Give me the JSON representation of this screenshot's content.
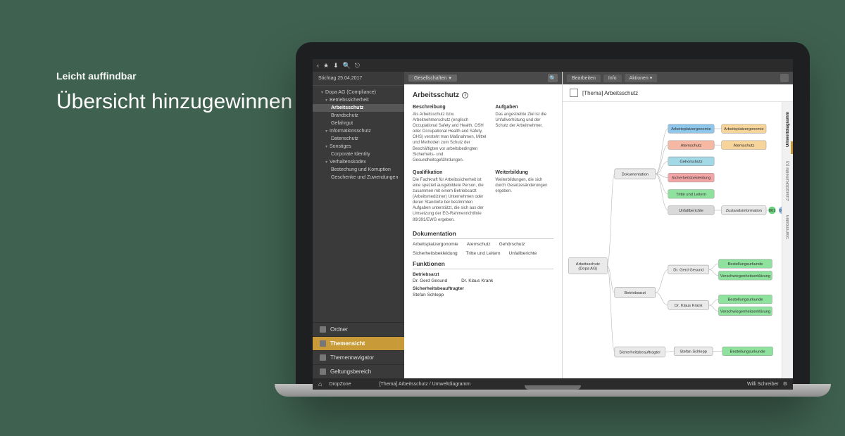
{
  "marketing": {
    "eyebrow": "Leicht auffindbar",
    "title": "Übersicht hinzugewinnen durch einheitliche Struktur."
  },
  "toolbar": {
    "icons": [
      "chevron-left",
      "star",
      "download",
      "search",
      "logout"
    ]
  },
  "sidebar": {
    "stichtag": "Stichtag 25.04.2017",
    "root": "Dopa AG (Compliance)",
    "tree": [
      {
        "label": "Betriebssicherheit",
        "open": true,
        "children": [
          {
            "label": "Arbeitsschutz",
            "selected": true
          },
          {
            "label": "Brandschutz"
          },
          {
            "label": "Gefahrgut"
          }
        ]
      },
      {
        "label": "Informationsschutz",
        "open": true,
        "children": [
          {
            "label": "Datenschutz"
          }
        ]
      },
      {
        "label": "Sonstiges",
        "open": true,
        "children": [
          {
            "label": "Corporate Identity"
          }
        ]
      },
      {
        "label": "Verhaltenskodex",
        "open": true,
        "children": [
          {
            "label": "Bestechung und Korruption"
          },
          {
            "label": "Geschenke und Zuwendungen"
          }
        ]
      }
    ],
    "nav": [
      {
        "label": "Ordner"
      },
      {
        "label": "Themensicht",
        "active": true
      },
      {
        "label": "Themennavigator"
      },
      {
        "label": "Geltungsbereich"
      }
    ]
  },
  "midfilter": {
    "label": "Gesellschaften"
  },
  "doc": {
    "title": "Arbeitsschutz",
    "sections": {
      "beschreibung_h": "Beschreibung",
      "beschreibung": "Als Arbeitsschutz bzw. Arbeitnehmerschutz (englisch Occupational Safety and Health, OSH oder Occupational Health and Safety, OHS) versteht man Maßnahmen, Mittel und Methoden zum Schutz der Beschäftigten vor arbeitsbedingten Sicherheits- und Gesundheitsgefährdungen.",
      "aufgaben_h": "Aufgaben",
      "aufgaben": "Das angestrebte Ziel ist die Unfallverhütung und der Schutz der Arbeitnehmer.",
      "qualifikation_h": "Qualifikation",
      "qualifikation": "Die Fachkraft für Arbeitssicherheit ist eine speziell ausgebildete Person, die zusammen mit einem Betriebsarzt (Arbeitsmediziner) Unternehmen oder deren Standorte bei bestimmten Aufgaben unterstützt, die sich aus der Umsetzung der EG-Rahmenrichtlinie 89/391/EWG ergeben.",
      "weiterbildung_h": "Weiterbildung",
      "weiterbildung": "Weiterbildungen, die sich durch Gesetzesänderungen ergeben."
    },
    "dokumentation_h": "Dokumentation",
    "dokumentation": [
      "Arbeitsplatzergonomie",
      "Atemschutz",
      "Gehörschutz",
      "Sicherheitsbekleidung",
      "Tritte und Leitern",
      "Unfallberichte"
    ],
    "funktionen_h": "Funktionen",
    "funktionen": {
      "betriebsarzt_h": "Betriebsarzt",
      "betriebsaerzte": [
        "Dr. Gerd Gesund",
        "Dr. Klaus Krank"
      ],
      "sib_h": "Sicherheitsbeauftragter",
      "sib": "Stefan Schlepp"
    }
  },
  "rightpanel": {
    "tabs": [
      "Bearbeiten",
      "Info",
      "Aktionen"
    ],
    "heading": "[Thema] Arbeitsschutz",
    "sidetabs": [
      "Umweltdiagramm",
      "Zusatzdokumente (0)",
      "Stammdaten"
    ]
  },
  "diagram": {
    "root": "Arbeitsschutz\n(Dopa AG)",
    "hubs": [
      "Dokumentation",
      "Betriebsarzt",
      "Sicherheitsbeauftragter"
    ],
    "doc_leaves": [
      {
        "label": "Arbeitsplatzergonomie",
        "color": "#8fc7ec",
        "extra": "Arbeitsplatzergonomie",
        "extra_color": "#f7d49a"
      },
      {
        "label": "Atemschutz",
        "color": "#f6b7a3",
        "extra": "Atemschutz",
        "extra_color": "#f7d49a"
      },
      {
        "label": "Gehörschutz",
        "color": "#a3d8e6"
      },
      {
        "label": "Sicherheitsbekleidung",
        "color": "#f4a6a6"
      },
      {
        "label": "Tritte und Leitern",
        "color": "#8fe29d"
      },
      {
        "label": "Unfallberichte",
        "color": "#d9d9d9",
        "extra": "Zustandsinformation",
        "extra_color": "#e9e9e9",
        "dots": [
          "#6ad07c",
          "#8fb9ea"
        ]
      }
    ],
    "ba_people": [
      {
        "name": "Dr. Gerd Gesund",
        "docs": [
          "Bestellungsurkunde",
          "Verschwiegenheitserklärung"
        ]
      },
      {
        "name": "Dr. Klaus Krank",
        "docs": [
          "Bestellungsurkunde",
          "Verschwiegenheitserklärung"
        ]
      }
    ],
    "sib_person": {
      "name": "Stefan Schlepp",
      "docs": [
        "Bestellungsurkunde"
      ]
    }
  },
  "footer": {
    "dropzone": "DropZone",
    "breadcrumb": "[Thema] Arbeitsschutz  /  Umweltdiagramm",
    "user": "Willi Schreiber"
  }
}
